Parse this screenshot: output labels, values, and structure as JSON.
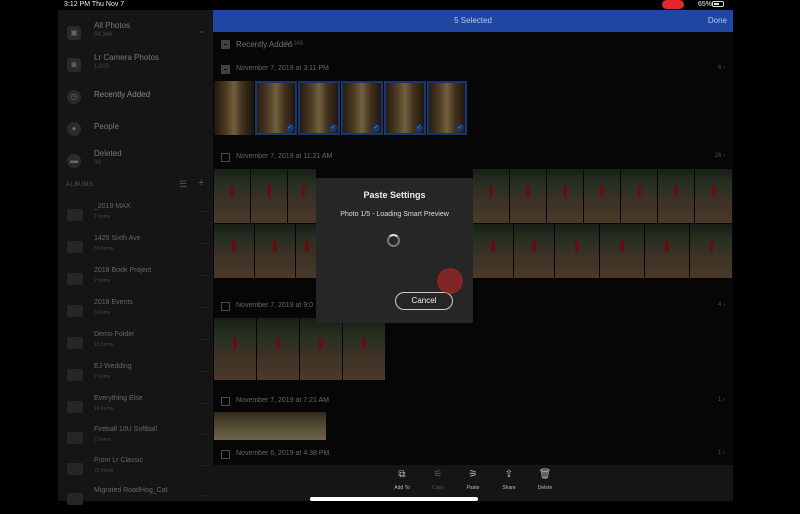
{
  "status": {
    "time": "3:12 PM  Thu Nov 7",
    "battery": "65%"
  },
  "sidebar": {
    "items": [
      {
        "label": "All Photos",
        "sub": "84,346"
      },
      {
        "label": "Lr Camera Photos",
        "sub": "1,003"
      },
      {
        "label": "Recently Added",
        "sub": ""
      },
      {
        "label": "People",
        "sub": ""
      },
      {
        "label": "Deleted",
        "sub": "38"
      }
    ],
    "albums_header": "ALBUMS",
    "albums": [
      {
        "label": "_2019 MAX",
        "sub": "7 Items"
      },
      {
        "label": "1425 Sixth Ave",
        "sub": "59 Items"
      },
      {
        "label": "2018 Book Project",
        "sub": "2 Items"
      },
      {
        "label": "2018 Events",
        "sub": "3 Items"
      },
      {
        "label": "Demo Folder",
        "sub": "15 Items"
      },
      {
        "label": "EJ Wedding",
        "sub": "7 Items"
      },
      {
        "label": "Everything Else",
        "sub": "14 Items"
      },
      {
        "label": "Fireball 10U Softball",
        "sub": "2 Items"
      },
      {
        "label": "From Lr Classic",
        "sub": "72 Items"
      },
      {
        "label": "Migrated RoadHog_Cat",
        "sub": ""
      }
    ]
  },
  "topbar": {
    "title": "5 Selected",
    "done": "Done"
  },
  "main": {
    "header": {
      "label": "Recently Added",
      "count": "84,346"
    },
    "groups": [
      {
        "label": "November 7, 2019 at 3:11 PM",
        "count": "6"
      },
      {
        "label": "November 7, 2019 at 11:21 AM",
        "count": "26"
      },
      {
        "label": "November 7, 2019 at 9:0",
        "count": "4"
      },
      {
        "label": "November 7, 2019 at 7:21 AM",
        "count": "1"
      },
      {
        "label": "November 6, 2019 at 4:38 PM",
        "count": "1"
      }
    ]
  },
  "dialog": {
    "title": "Paste Settings",
    "subtitle": "Photo 1/5 - Loading Smart Preview",
    "cancel": "Cancel"
  },
  "toolbar": [
    {
      "label": "Add To",
      "icon": "add-to-icon",
      "enabled": true
    },
    {
      "label": "Copy",
      "icon": "copy-settings-icon",
      "enabled": false
    },
    {
      "label": "Paste",
      "icon": "paste-settings-icon",
      "enabled": true
    },
    {
      "label": "Share",
      "icon": "share-icon",
      "enabled": true
    },
    {
      "label": "Delete",
      "icon": "trash-icon",
      "enabled": true
    }
  ],
  "colors": {
    "accent": "#1f47a2",
    "selection": "#2a63d3"
  }
}
